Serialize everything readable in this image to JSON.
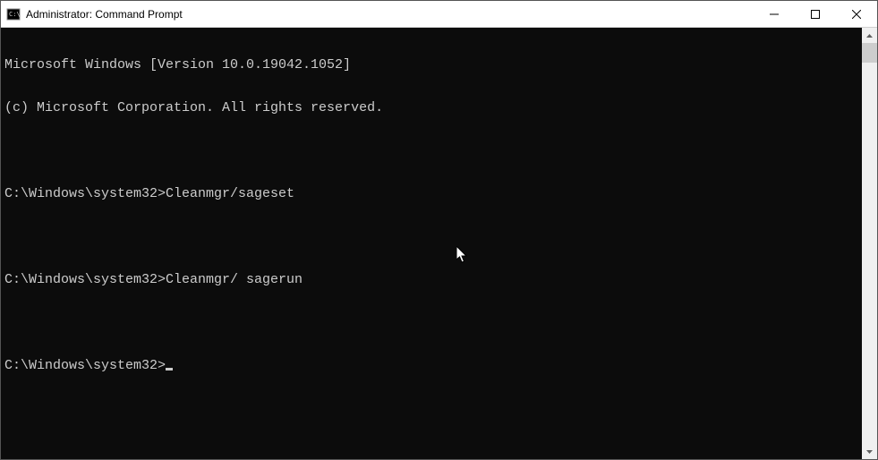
{
  "window": {
    "title": "Administrator: Command Prompt"
  },
  "terminal": {
    "line1": "Microsoft Windows [Version 10.0.19042.1052]",
    "line2": "(c) Microsoft Corporation. All rights reserved.",
    "blank1": "",
    "cmd1_prompt": "C:\\Windows\\system32>",
    "cmd1_text": "Cleanmgr/sageset",
    "blank2": "",
    "cmd2_prompt": "C:\\Windows\\system32>",
    "cmd2_text": "Cleanmgr/ sagerun",
    "blank3": "",
    "cmd3_prompt": "C:\\Windows\\system32>"
  }
}
